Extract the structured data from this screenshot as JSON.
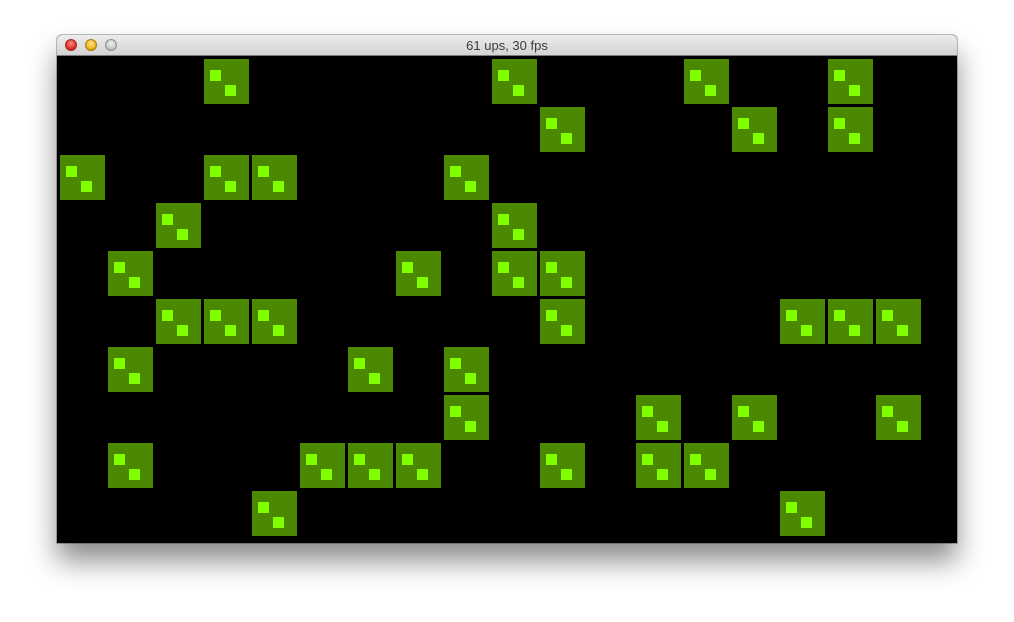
{
  "window": {
    "title": "61 ups, 30 fps",
    "buttons": [
      "close",
      "minimize",
      "zoom"
    ]
  },
  "game": {
    "grid": {
      "columns": 18,
      "rows": 10
    },
    "colors": {
      "background": "#000000",
      "cell": "#4b8a00",
      "pip": "#7fff00"
    },
    "live_cells": [
      [
        3,
        0
      ],
      [
        9,
        0
      ],
      [
        13,
        0
      ],
      [
        16,
        0
      ],
      [
        10,
        1
      ],
      [
        14,
        1
      ],
      [
        16,
        1
      ],
      [
        0,
        2
      ],
      [
        3,
        2
      ],
      [
        4,
        2
      ],
      [
        8,
        2
      ],
      [
        2,
        3
      ],
      [
        9,
        3
      ],
      [
        1,
        4
      ],
      [
        7,
        4
      ],
      [
        9,
        4
      ],
      [
        10,
        4
      ],
      [
        2,
        5
      ],
      [
        3,
        5
      ],
      [
        4,
        5
      ],
      [
        10,
        5
      ],
      [
        15,
        5
      ],
      [
        16,
        5
      ],
      [
        17,
        5
      ],
      [
        1,
        6
      ],
      [
        6,
        6
      ],
      [
        8,
        6
      ],
      [
        8,
        7
      ],
      [
        12,
        7
      ],
      [
        14,
        7
      ],
      [
        17,
        7
      ],
      [
        1,
        8
      ],
      [
        5,
        8
      ],
      [
        6,
        8
      ],
      [
        7,
        8
      ],
      [
        10,
        8
      ],
      [
        12,
        8
      ],
      [
        13,
        8
      ],
      [
        4,
        9
      ],
      [
        15,
        9
      ]
    ]
  }
}
